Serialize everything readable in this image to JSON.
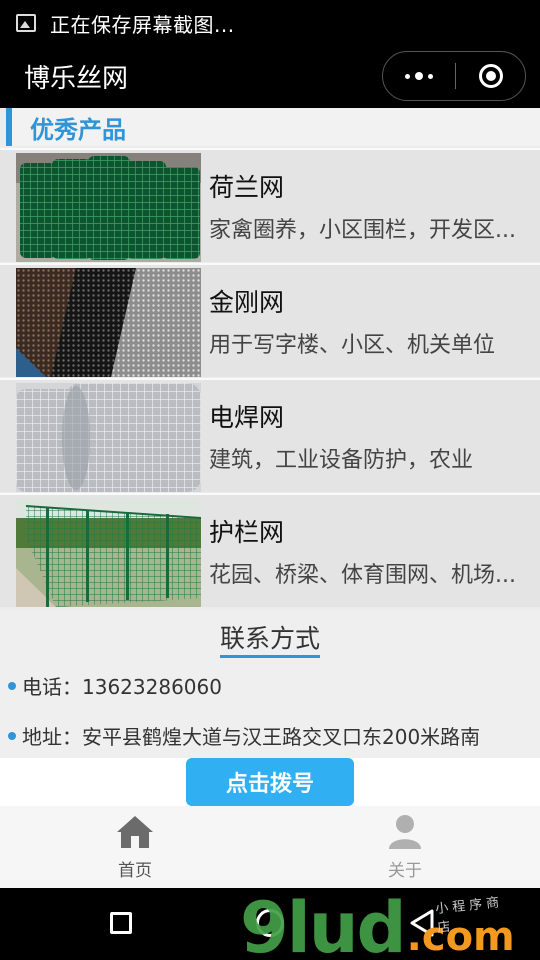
{
  "status_bar": {
    "text": "正在保存屏幕截图..."
  },
  "app_bar": {
    "title": "博乐丝网"
  },
  "section": {
    "title": "优秀产品"
  },
  "products": [
    {
      "name": "荷兰网",
      "desc": "家禽圈养，小区围栏，开发区..."
    },
    {
      "name": "金刚网",
      "desc": "用于写字楼、小区、机关单位"
    },
    {
      "name": "电焊网",
      "desc": "建筑，工业设备防护，农业"
    },
    {
      "name": "护栏网",
      "desc": "花园、桥梁、体育围网、机场..."
    }
  ],
  "contact": {
    "title": "联系方式",
    "phone": "电话：13623286060",
    "address": "地址：安平县鹤煌大道与汉王路交叉口东200米路南"
  },
  "call_button": {
    "label": "点击拨号"
  },
  "tabs": [
    {
      "label": "首页",
      "icon": "house-icon"
    },
    {
      "label": "关于",
      "icon": "person-icon"
    }
  ],
  "watermark": {
    "main": "9lud",
    "suffix": ".com",
    "small": "小程序商店"
  },
  "colors": {
    "accent": "#2f94d8",
    "button": "#31aff3",
    "watermark_green": "#43a047",
    "watermark_orange": "#f39a1e"
  }
}
